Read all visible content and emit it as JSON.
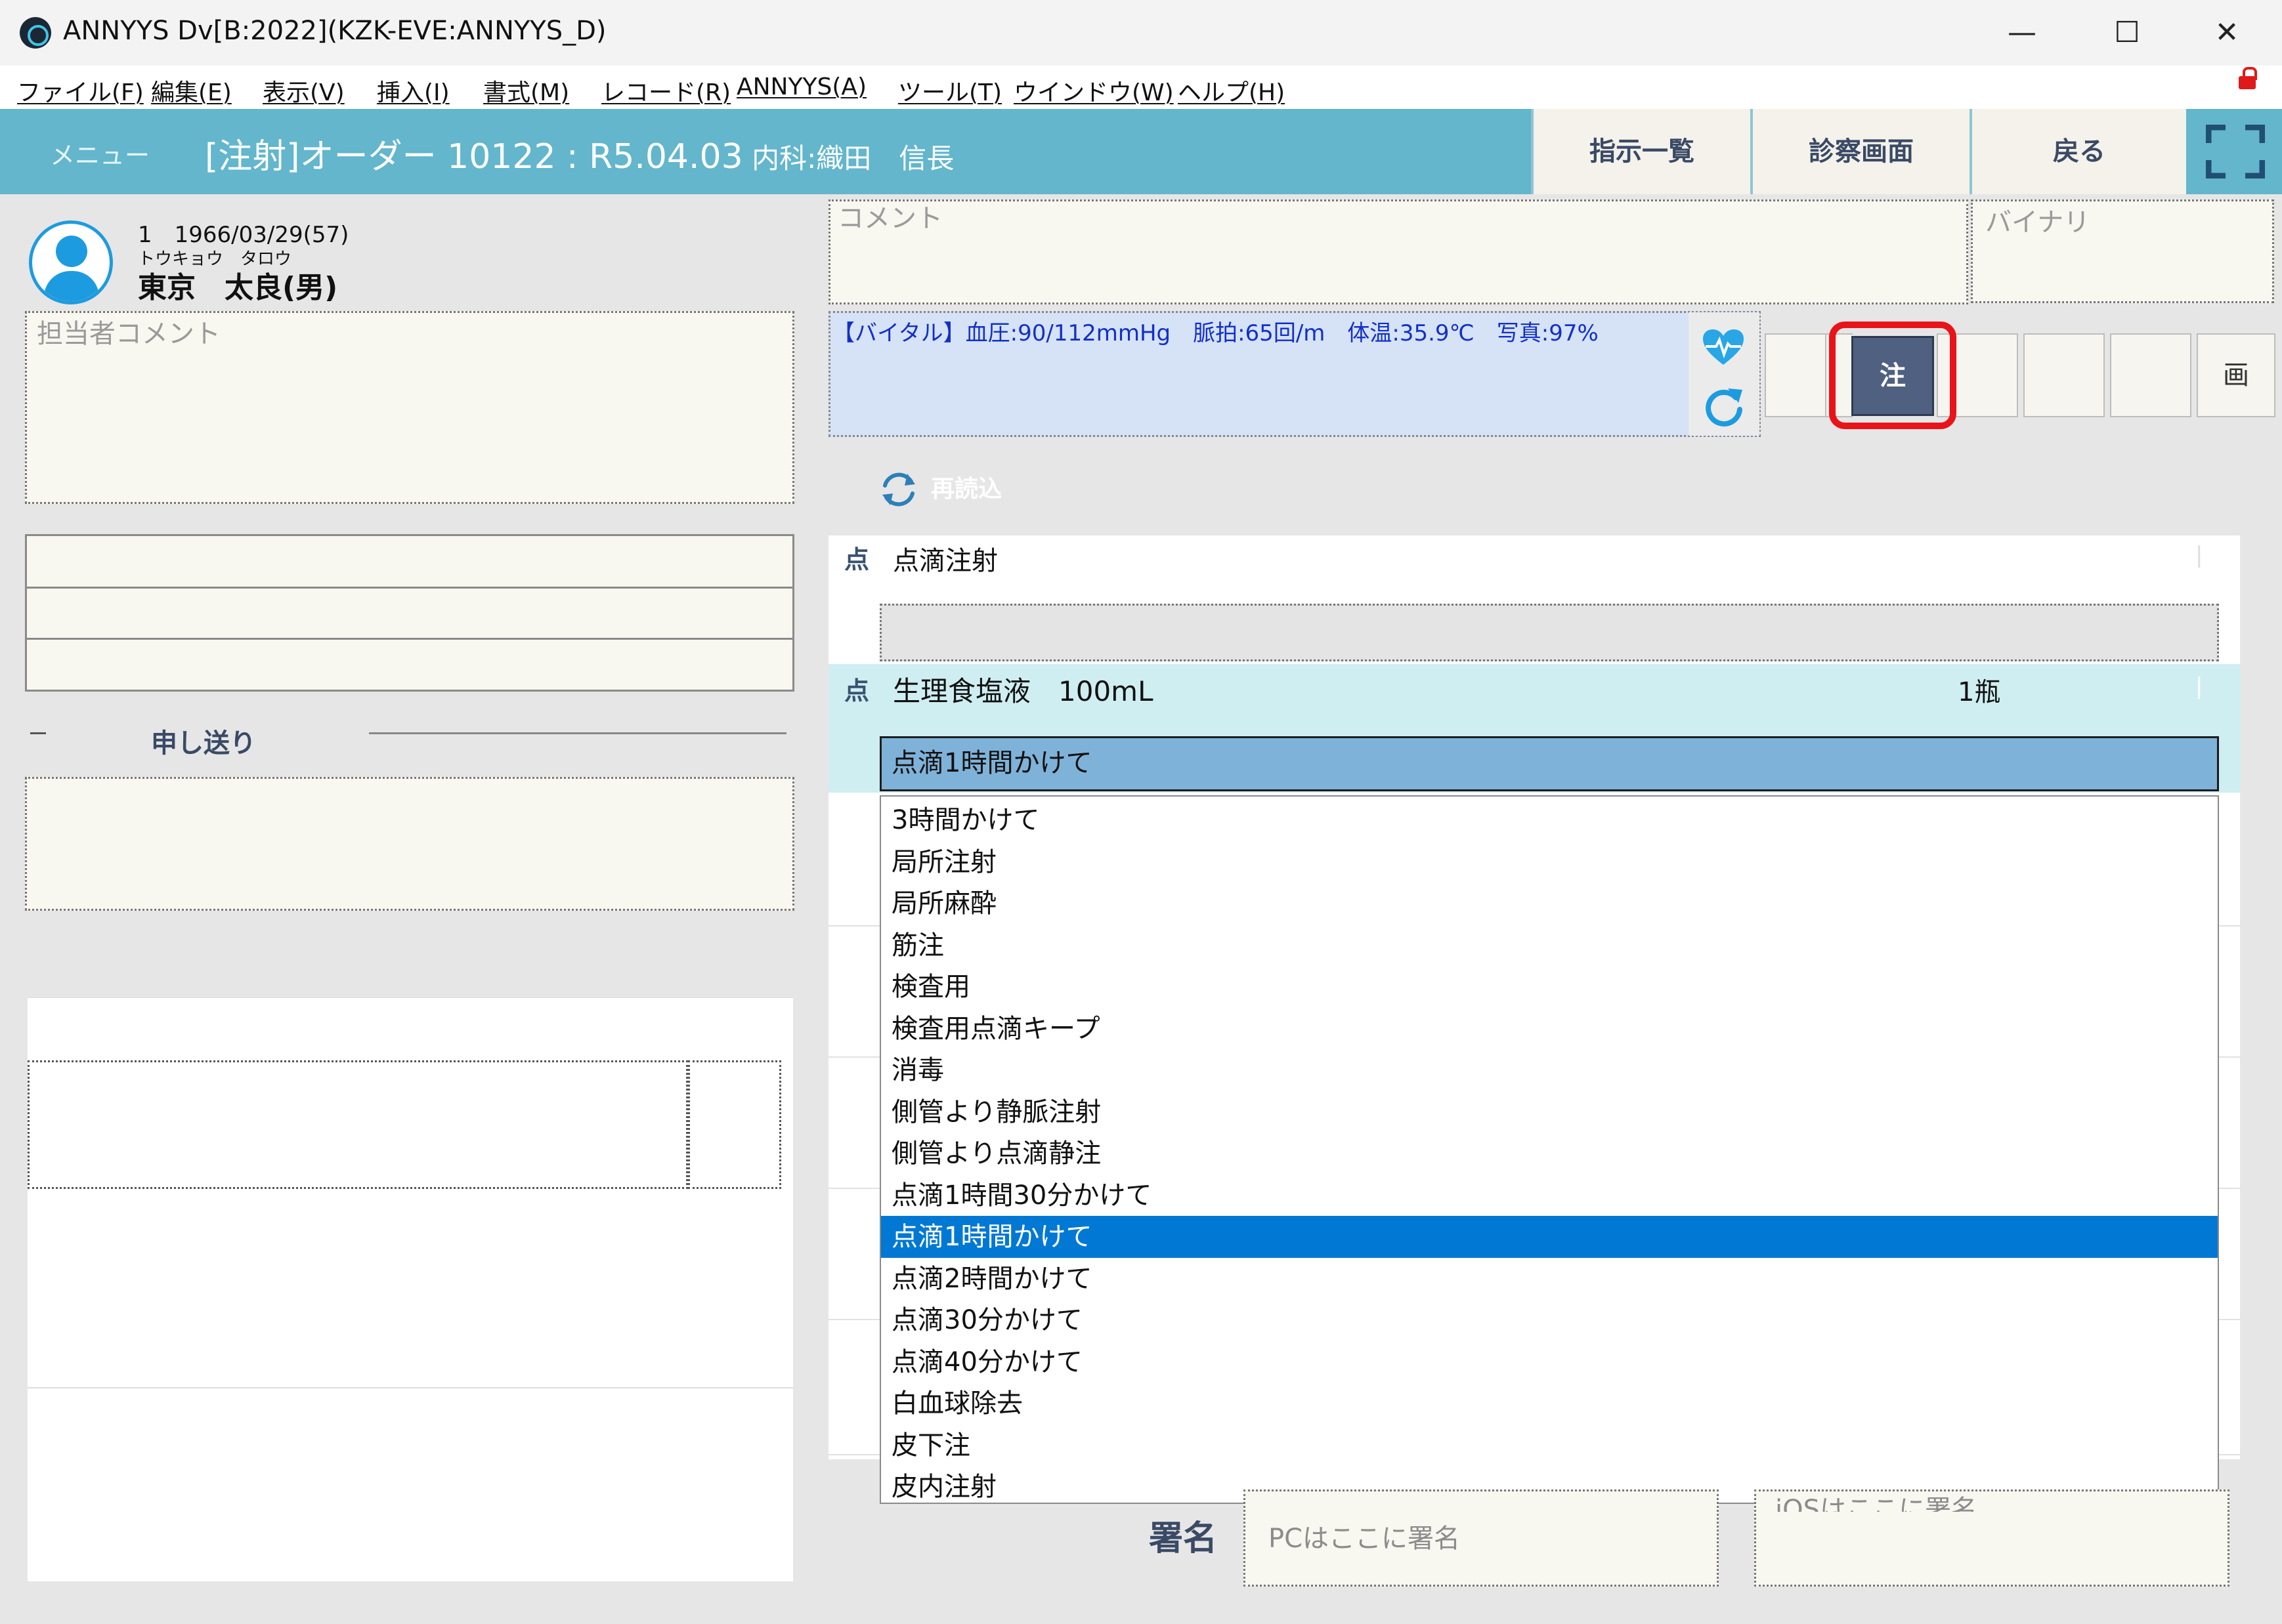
{
  "window": {
    "title": "ANNYYS Dv[B:2022](KZK-EVE:ANNYYS_D)",
    "minimize": "—",
    "maximize": "☐",
    "close": "✕"
  },
  "menubar": [
    "ファイル(F)",
    "編集(E)",
    "表示(V)",
    "挿入(I)",
    "書式(M)",
    "レコード(R)",
    "ANNYYS(A)",
    "ツール(T)",
    "ウインドウ(W)",
    "ヘルプ(H)"
  ],
  "header": {
    "menu_link": "メニュー",
    "title_main": "[注射]オーダー 10122 : R5.04.03",
    "title_sub": " 内科:織田　信長",
    "buttons": [
      "指示一覧",
      "診察画面",
      "戻る"
    ]
  },
  "patient": {
    "id_line": "1　1966/03/29(57)",
    "kana": "トウキョウ　タロウ",
    "name": "東京　太良(男)"
  },
  "left": {
    "staff_comment_placeholder": "担当者コメント",
    "handover_label": "申し送り"
  },
  "right": {
    "comment_placeholder": "コメント",
    "binary_placeholder": "バイナリ",
    "vital_text": "【バイタル】血圧:90/112mmHg　脈拍:65回/m　体温:35.9℃　写真:97%",
    "reload_label": "再読込",
    "tool_btn_active": "注",
    "tool_btn_last": "画"
  },
  "orders": [
    {
      "mark": "点",
      "name": "点滴注射",
      "end": "|"
    },
    {
      "mark": "点",
      "name": "生理食塩液　100mL",
      "qty": "1瓶",
      "end": "|"
    }
  ],
  "combo": {
    "value": "点滴1時間かけて",
    "options": [
      "3時間かけて",
      "局所注射",
      "局所麻酔",
      "筋注",
      "検査用",
      "検査用点滴キープ",
      "消毒",
      "側管より静脈注射",
      "側管より点滴静注",
      "点滴1時間30分かけて",
      "点滴1時間かけて",
      "点滴2時間かけて",
      "点滴30分かけて",
      "点滴40分かけて",
      "白血球除去",
      "皮下注",
      "皮内注射"
    ],
    "selected_index": 10
  },
  "signature": {
    "label": "署名",
    "pc_placeholder": "PCはここに署名",
    "ios_placeholder": "iOSはここに署名"
  },
  "colors": {
    "header_bg": "#63b6cc",
    "selected_item": "#0078d4",
    "vital_bg": "#d6e2f6",
    "active_tool": "#4f6080",
    "highlight": "#e8141a"
  }
}
